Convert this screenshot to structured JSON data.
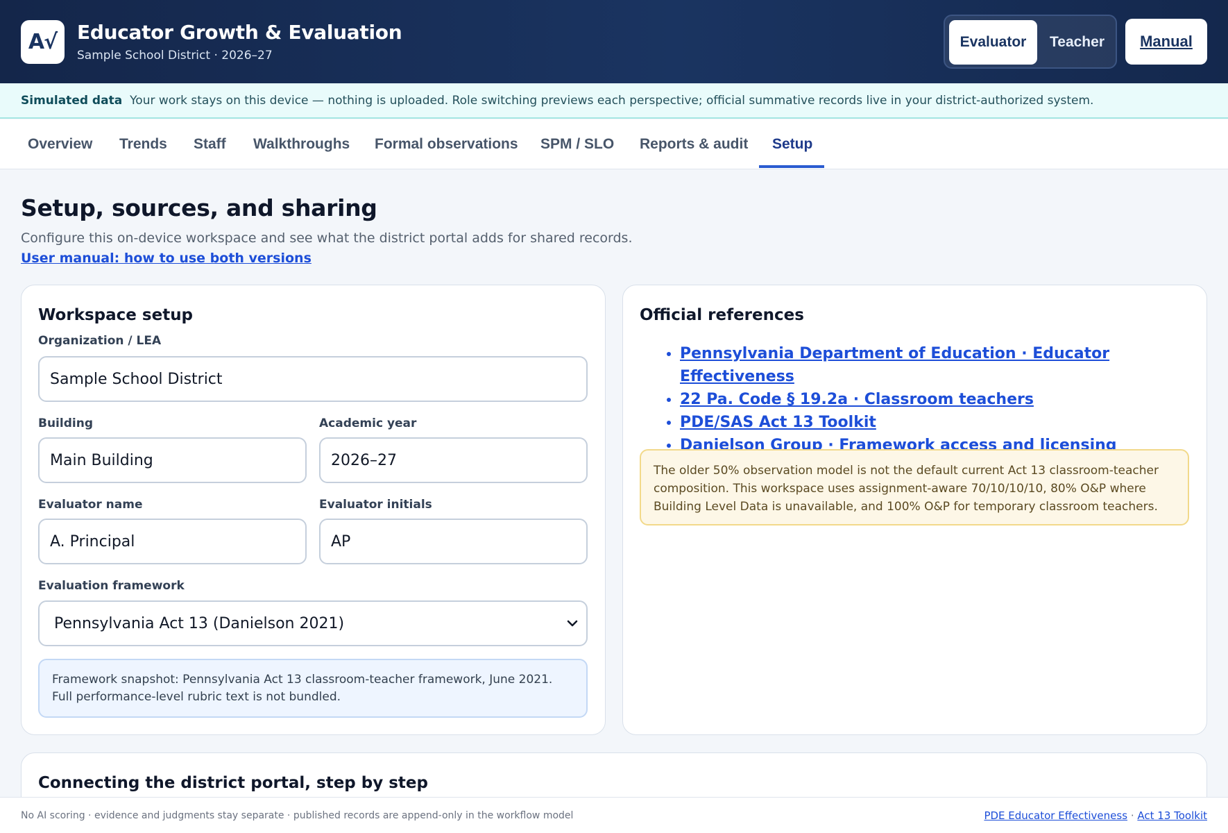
{
  "header": {
    "logo_text": "A√",
    "title": "Educator Growth & Evaluation",
    "subtitle": "Sample School District · 2026–27",
    "roles": [
      "Evaluator",
      "Teacher"
    ],
    "active_role": "Evaluator",
    "manual_label": "Manual"
  },
  "banner": {
    "label": "Simulated data",
    "text": "Your work stays on this device — nothing is uploaded. Role switching previews each perspective; official summative records live in your district-authorized system."
  },
  "nav": {
    "tabs": [
      "Overview",
      "Trends",
      "Staff",
      "Walkthroughs",
      "Formal observations",
      "SPM / SLO",
      "Reports & audit",
      "Setup"
    ],
    "active_tab": "Setup"
  },
  "page": {
    "title": "Setup, sources, and sharing",
    "description": "Configure this on-device workspace and see what the district portal adds for shared records.",
    "manual_link": "User manual: how to use both versions"
  },
  "workspace": {
    "heading": "Workspace setup",
    "org_label": "Organization / LEA",
    "org_value": "Sample School District",
    "building_label": "Building",
    "building_value": "Main Building",
    "year_label": "Academic year",
    "year_value": "2026–27",
    "evaluator_name_label": "Evaluator name",
    "evaluator_name_value": "A. Principal",
    "evaluator_initials_label": "Evaluator initials",
    "evaluator_initials_value": "AP",
    "framework_label": "Evaluation framework",
    "framework_value": "Pennsylvania Act 13 (Danielson 2021)",
    "snapshot_note": "Framework snapshot: Pennsylvania Act 13 classroom-teacher framework, June 2021. Full performance-level rubric text is not bundled."
  },
  "references": {
    "heading": "Official references",
    "links": [
      "Pennsylvania Department of Education · Educator Effectiveness",
      "22 Pa. Code § 19.2a · Classroom teachers",
      "PDE/SAS Act 13 Toolkit",
      "Danielson Group · Framework access and licensing"
    ],
    "note": "The older 50% observation model is not the default current Act 13 classroom-teacher composition. This workspace uses assignment-aware 70/10/10/10, 80% O&P where Building Level Data is unavailable, and 100% O&P for temporary classroom teachers."
  },
  "portal": {
    "heading": "Connecting the district portal, step by step"
  },
  "footer": {
    "text": "No AI scoring · evidence and judgments stay separate · published records are append-only in the workflow model",
    "link1": "PDE Educator Effectiveness",
    "separator": "·",
    "link2": "Act 13 Toolkit"
  }
}
